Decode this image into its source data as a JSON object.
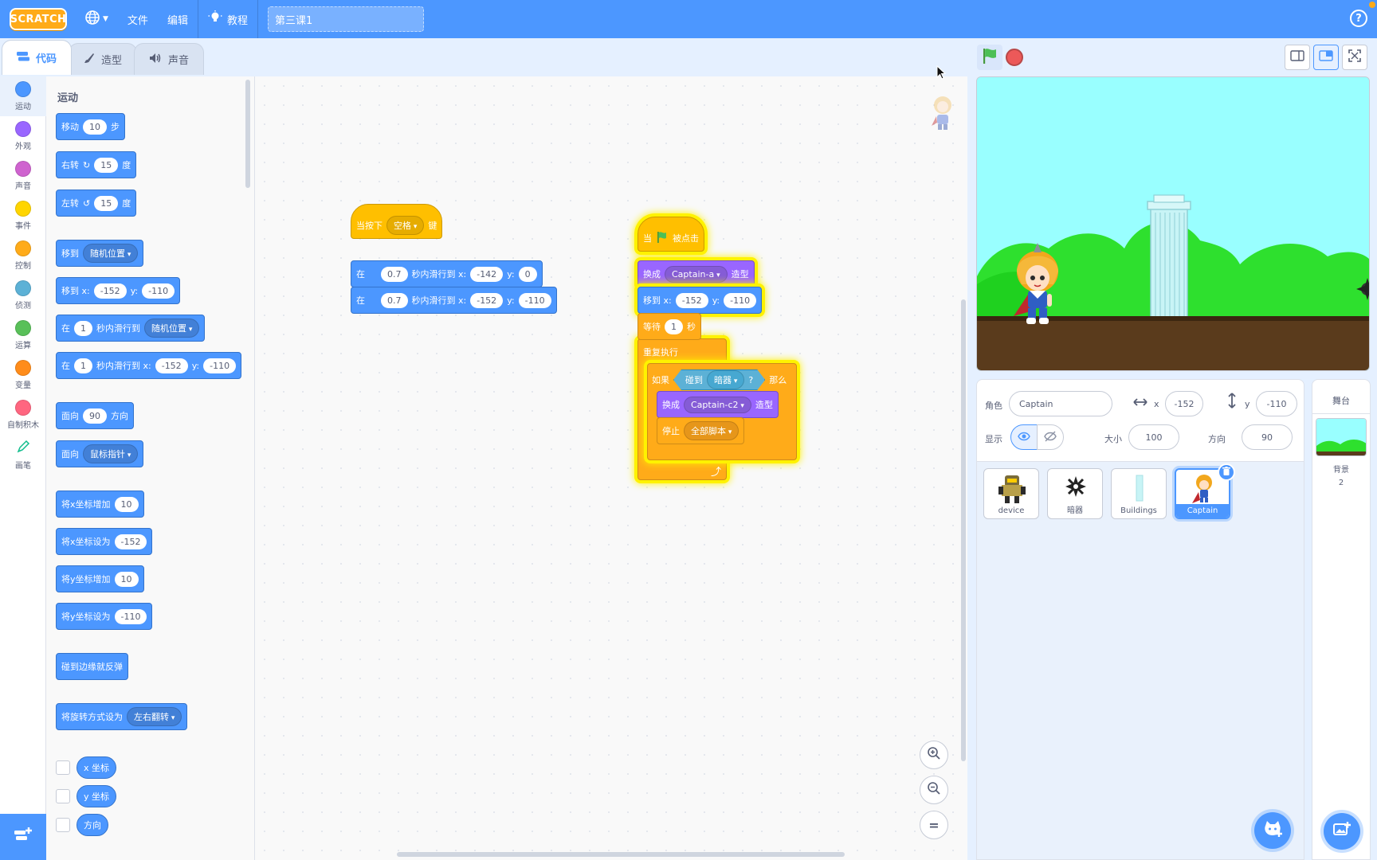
{
  "menubar": {
    "logo": "SCRATCH",
    "file": "文件",
    "edit": "编辑",
    "tutorials": "教程",
    "project_title": "第三课1"
  },
  "tabs": {
    "code": "代码",
    "costumes": "造型",
    "sounds": "声音"
  },
  "categories": [
    {
      "label": "运动",
      "color": "#4c97ff"
    },
    {
      "label": "外观",
      "color": "#9966ff"
    },
    {
      "label": "声音",
      "color": "#cf63cf"
    },
    {
      "label": "事件",
      "color": "#ffd500"
    },
    {
      "label": "控制",
      "color": "#ffab19"
    },
    {
      "label": "侦测",
      "color": "#5cb1d6"
    },
    {
      "label": "运算",
      "color": "#59c059"
    },
    {
      "label": "变量",
      "color": "#ff8c1a"
    },
    {
      "label": "自制积木",
      "color": "#ff6680"
    },
    {
      "label": "画笔",
      "color": "#0fbd8c"
    }
  ],
  "palette": {
    "title": "运动",
    "move": {
      "a": "移动",
      "v": "10",
      "b": "步"
    },
    "turn_right": {
      "a": "右转",
      "v": "15",
      "b": "度"
    },
    "turn_left": {
      "a": "左转",
      "v": "15",
      "b": "度"
    },
    "goto": {
      "a": "移到",
      "dd": "随机位置"
    },
    "goto_xy": {
      "a": "移到 x:",
      "x": "-152",
      "yl": "y:",
      "y": "-110"
    },
    "glide": {
      "a": "在",
      "v": "1",
      "b": "秒内滑行到",
      "dd": "随机位置"
    },
    "glide_xy": {
      "a": "在",
      "v": "1",
      "b": "秒内滑行到 x:",
      "x": "-152",
      "yl": "y:",
      "y": "-110"
    },
    "point_dir": {
      "a": "面向",
      "v": "90",
      "b": "方向"
    },
    "point_towards": {
      "a": "面向",
      "dd": "鼠标指针"
    },
    "change_x": {
      "a": "将x坐标增加",
      "v": "10"
    },
    "set_x": {
      "a": "将x坐标设为",
      "v": "-152"
    },
    "change_y": {
      "a": "将y坐标增加",
      "v": "10"
    },
    "set_y": {
      "a": "将y坐标设为",
      "v": "-110"
    },
    "bounce": "碰到边缘就反弹",
    "rotation_style": {
      "a": "将旋转方式设为",
      "dd": "左右翻转"
    },
    "rep_x": "x 坐标",
    "rep_y": "y 坐标",
    "rep_dir": "方向"
  },
  "script1": {
    "hat": {
      "a": "当按下",
      "dd": "空格",
      "b": "键"
    },
    "glide1": {
      "a": "在",
      "t": "0.7",
      "b": "秒内滑行到 x:",
      "x": "-142",
      "yl": "y:",
      "y": "0"
    },
    "glide2": {
      "a": "在",
      "t": "0.7",
      "b": "秒内滑行到 x:",
      "x": "-152",
      "yl": "y:",
      "y": "-110"
    }
  },
  "script2": {
    "hat": {
      "a": "当",
      "b": "被点击"
    },
    "switch1": {
      "a": "换成",
      "dd": "Captain-a",
      "b": "造型"
    },
    "goto": {
      "a": "移到 x:",
      "x": "-152",
      "yl": "y:",
      "y": "-110"
    },
    "wait": {
      "a": "等待",
      "v": "1",
      "b": "秒"
    },
    "forever": "重复执行",
    "if": {
      "a": "如果",
      "touch": "碰到",
      "dd": "暗器",
      "q": "?",
      "b": "那么"
    },
    "switch2": {
      "a": "换成",
      "dd": "Captain-c2",
      "b": "造型"
    },
    "stop": {
      "a": "停止",
      "dd": "全部脚本"
    }
  },
  "sprite_info": {
    "sprite_label": "角色",
    "sprite_name": "Captain",
    "x_label": "x",
    "x": "-152",
    "y_label": "y",
    "y": "-110",
    "show_label": "显示",
    "size_label": "大小",
    "size": "100",
    "direction_label": "方向",
    "direction": "90"
  },
  "sprites": [
    {
      "name": "device"
    },
    {
      "name": "暗器"
    },
    {
      "name": "Buildings"
    },
    {
      "name": "Captain"
    }
  ],
  "stage_selector": {
    "title": "舞台",
    "backdrops_label": "背景",
    "backdrops_count": "2"
  },
  "colors": {
    "menubar": "#4c97ff",
    "motion": "#4c97ff",
    "looks": "#9966ff",
    "events": "#ffbf00",
    "control": "#ffab19",
    "sensing": "#5cb1d6"
  }
}
